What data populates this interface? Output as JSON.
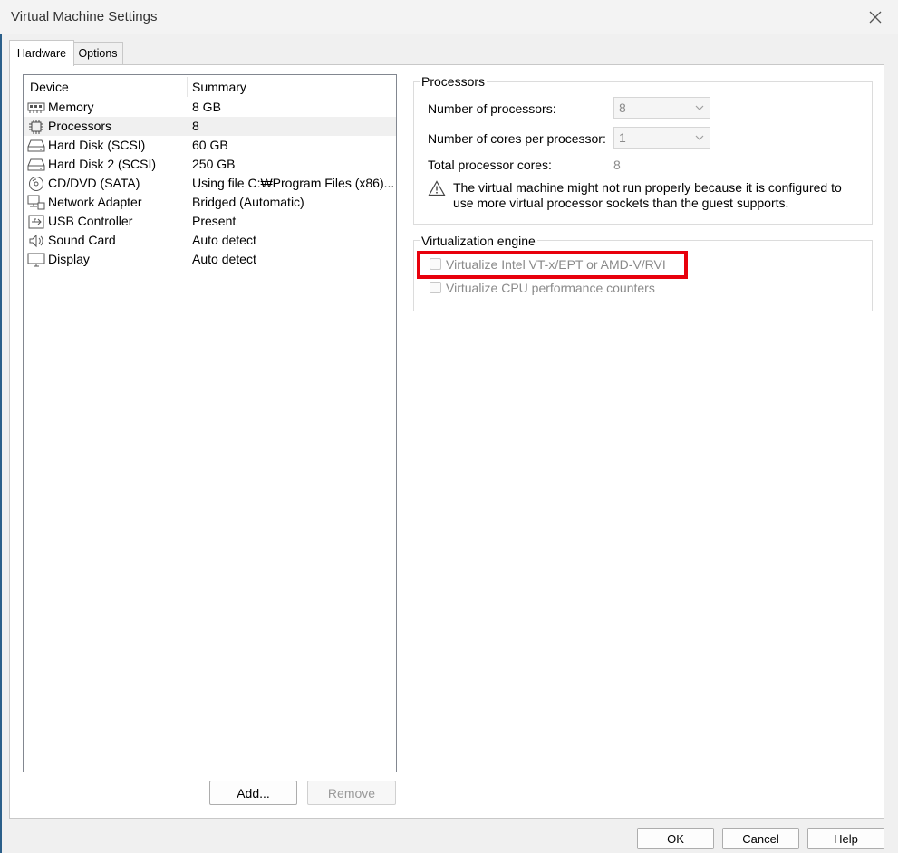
{
  "window": {
    "title": "Virtual Machine Settings",
    "close_icon": "close-icon"
  },
  "tabs": [
    {
      "label": "Hardware",
      "active": true
    },
    {
      "label": "Options",
      "active": false
    }
  ],
  "device_list": {
    "columns": [
      "Device",
      "Summary"
    ],
    "rows": [
      {
        "device": "Memory",
        "summary": "8 GB",
        "icon": "memory-icon"
      },
      {
        "device": "Processors",
        "summary": "8",
        "icon": "processor-icon",
        "selected": true
      },
      {
        "device": "Hard Disk (SCSI)",
        "summary": "60 GB",
        "icon": "hard-disk-icon"
      },
      {
        "device": "Hard Disk 2 (SCSI)",
        "summary": "250 GB",
        "icon": "hard-disk-icon"
      },
      {
        "device": "CD/DVD (SATA)",
        "summary": "Using file C:₩Program Files (x86)...",
        "icon": "cd-dvd-icon"
      },
      {
        "device": "Network Adapter",
        "summary": "Bridged (Automatic)",
        "icon": "network-adapter-icon"
      },
      {
        "device": "USB Controller",
        "summary": "Present",
        "icon": "usb-icon"
      },
      {
        "device": "Sound Card",
        "summary": "Auto detect",
        "icon": "speaker-icon"
      },
      {
        "device": "Display",
        "summary": "Auto detect",
        "icon": "monitor-icon"
      }
    ]
  },
  "list_buttons": {
    "add": "Add...",
    "remove": "Remove"
  },
  "processors": {
    "group_label": "Processors",
    "num_processors_label": "Number of processors:",
    "num_processors_value": "8",
    "cores_per_processor_label": "Number of cores per processor:",
    "cores_per_processor_value": "1",
    "total_cores_label": "Total processor cores:",
    "total_cores_value": "8",
    "warning_text_line1": "The virtual machine might not run properly because it is configured to",
    "warning_text_line2": "use more virtual processor sockets than the guest supports."
  },
  "virtualization": {
    "group_label": "Virtualization engine",
    "vtx_label": "Virtualize Intel VT-x/EPT or AMD-V/RVI",
    "vtx_checked": false,
    "cpu_counters_label": "Virtualize CPU performance counters",
    "cpu_counters_checked": false
  },
  "dialog_buttons": {
    "ok": "OK",
    "cancel": "Cancel",
    "help": "Help"
  },
  "colors": {
    "highlight": "#e8000c",
    "selected_row": "#f0f0f0"
  }
}
